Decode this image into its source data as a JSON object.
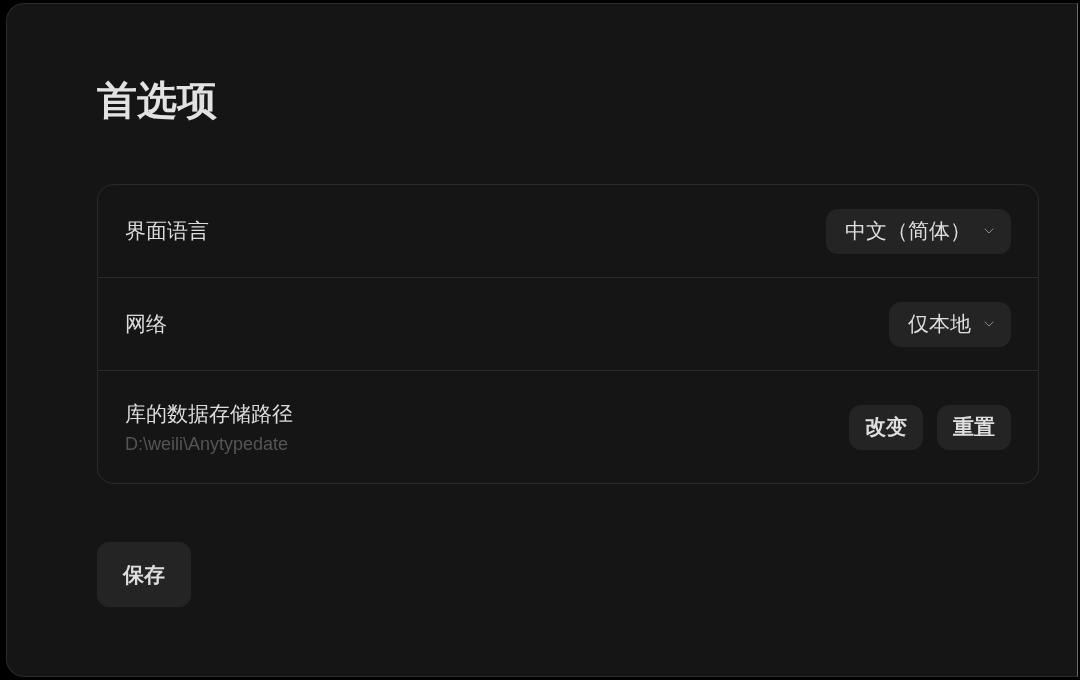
{
  "title": "首选项",
  "settings": [
    {
      "kind": "dropdown",
      "label": "界面语言",
      "value": "中文（简体）"
    },
    {
      "kind": "dropdown",
      "label": "网络",
      "value": "仅本地"
    },
    {
      "kind": "actions",
      "label": "库的数据存储路径",
      "path": "D:\\weili\\Anytypedate",
      "buttons": [
        "改变",
        "重置"
      ]
    }
  ],
  "save_button": "保存"
}
